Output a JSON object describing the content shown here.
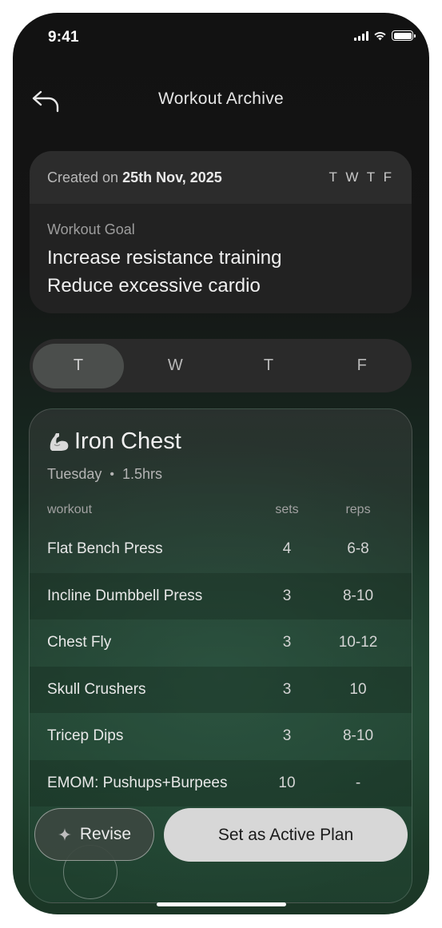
{
  "status_bar": {
    "time": "9:41"
  },
  "header": {
    "title": "Workout Archive"
  },
  "info_card": {
    "created_prefix": "Created on",
    "created_date": "25th Nov, 2025",
    "days_short": "T W T F",
    "goal_label": "Workout Goal",
    "goal_lines": [
      "Increase resistance training",
      "Reduce excessive cardio"
    ]
  },
  "day_tabs": [
    {
      "label": "T",
      "active": true
    },
    {
      "label": "W",
      "active": false
    },
    {
      "label": "T",
      "active": false
    },
    {
      "label": "F",
      "active": false
    }
  ],
  "workout": {
    "title": "Iron Chest",
    "day": "Tuesday",
    "duration": "1.5hrs",
    "columns": {
      "name": "workout",
      "sets": "sets",
      "reps": "reps"
    },
    "rows": [
      {
        "name": "Flat Bench Press",
        "sets": "4",
        "reps": "6-8"
      },
      {
        "name": "Incline Dumbbell Press",
        "sets": "3",
        "reps": "8-10"
      },
      {
        "name": "Chest Fly",
        "sets": "3",
        "reps": "10-12"
      },
      {
        "name": "Skull Crushers",
        "sets": "3",
        "reps": "10"
      },
      {
        "name": "Tricep Dips",
        "sets": "3",
        "reps": "8-10"
      },
      {
        "name": "EMOM: Pushups+Burpees",
        "sets": "10",
        "reps": "-"
      }
    ]
  },
  "actions": {
    "revise_label": "Revise",
    "set_active_label": "Set as Active Plan"
  },
  "icons": {
    "back": "back-arrow-icon",
    "workout": "flexed-biceps-icon",
    "revise": "sparkle-icon"
  }
}
